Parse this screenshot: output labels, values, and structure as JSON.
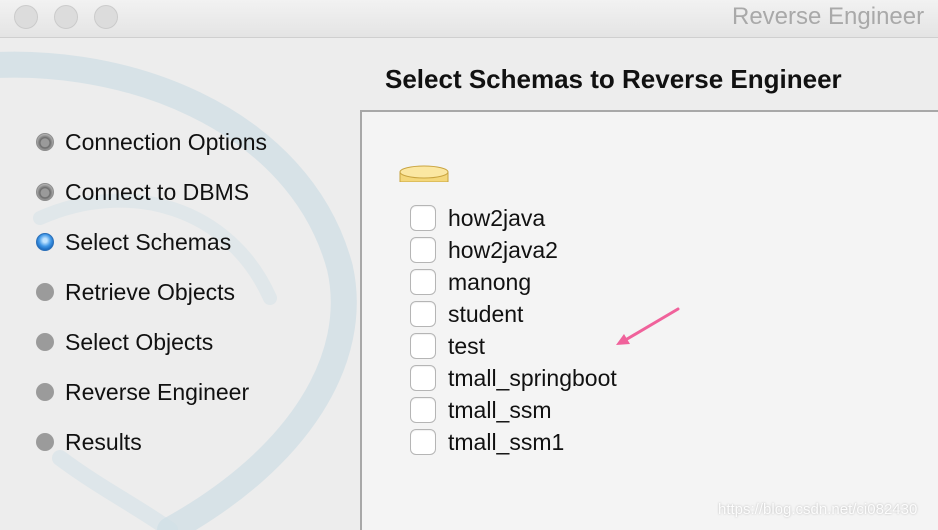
{
  "window": {
    "title": "Reverse Engineer"
  },
  "heading": "Select Schemas to Reverse Engineer",
  "steps": [
    {
      "label": "Connection Options",
      "state": "done"
    },
    {
      "label": "Connect to DBMS",
      "state": "done"
    },
    {
      "label": "Select Schemas",
      "state": "current"
    },
    {
      "label": "Retrieve Objects",
      "state": "pending"
    },
    {
      "label": "Select Objects",
      "state": "pending"
    },
    {
      "label": "Reverse Engineer",
      "state": "pending"
    },
    {
      "label": "Results",
      "state": "pending"
    }
  ],
  "schemas": [
    {
      "name": "how2java",
      "checked": false
    },
    {
      "name": "how2java2",
      "checked": false
    },
    {
      "name": "manong",
      "checked": false
    },
    {
      "name": "student",
      "checked": false
    },
    {
      "name": "test",
      "checked": false
    },
    {
      "name": "tmall_springboot",
      "checked": false
    },
    {
      "name": "tmall_ssm",
      "checked": false
    },
    {
      "name": "tmall_ssm1",
      "checked": false
    }
  ],
  "icons": {
    "database": "database-icon",
    "annotation": "pink-arrow-icon"
  },
  "colors": {
    "current_step": "#3f96e6",
    "annotation_arrow": "#f0629b",
    "db_icon": "#f4d77a"
  },
  "watermark": "https://blog.csdn.net/ci082430"
}
